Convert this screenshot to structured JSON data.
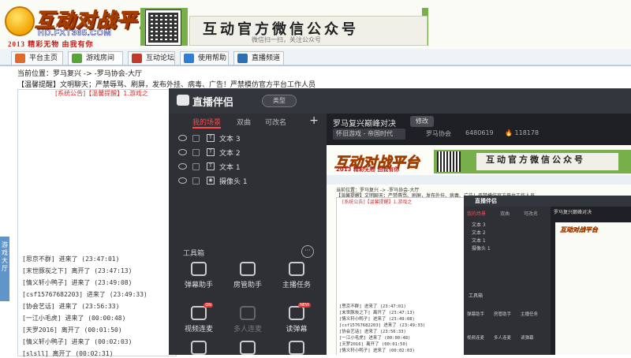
{
  "banner": {
    "logo_title": "互动对战平台",
    "logo_url": "HD.FXT365.COM",
    "logo_slogan": "2013 精彩无物 由我有你",
    "wechat_title": "互动官方微信公众号",
    "wechat_sub": "微信扫一扫，关注公众号"
  },
  "nav": {
    "tabs": [
      {
        "label": "平台主页",
        "icon": "home-icon",
        "color": "#e06a2b"
      },
      {
        "label": "游戏房间",
        "icon": "game-room-icon",
        "color": "#5aa33a"
      },
      {
        "label": "互动论坛",
        "icon": "forum-icon",
        "color": "#c0392b"
      },
      {
        "label": "使用帮助",
        "icon": "help-icon",
        "color": "#2d7fd1"
      },
      {
        "label": "直播频道",
        "icon": "live-icon",
        "color": "#2d6fb3"
      }
    ]
  },
  "location": "当前位置：罗马复兴 -> -罗马协会-大厅",
  "notice": "【温馨提醒】文明聊天；严禁辱骂、刷屏，发布外挂、病毒、广告！严禁模仿官方平台工作人员",
  "chat": {
    "header": "[系统公告]【温馨提醒】1.游戏之",
    "side_tab": "游戏大厅",
    "lines": [
      "[思京不群] 进来了 (23:47:01)",
      "[末世豚炭之下] 离开了 (23:47:13)",
      "[情义轩小鸭子] 进来了 (23:49:08)",
      "[csf15767682203] 进来了 (23:49:33)",
      "[协会艺话] 进来了 (23:56:33)",
      "[一江小毛虎] 进来了 (00:00:48)",
      "[天罗2016] 离开了 (00:01:50)",
      "[情义轩小鸭子] 进来了 (00:02:03)",
      "[slsll] 离开了 (00:02:31)"
    ]
  },
  "obs": {
    "app_name": "直播伴侣",
    "mode": "类型",
    "scene_tabs": [
      "我的场景",
      "双曲",
      "可改名"
    ],
    "sources": [
      {
        "type": "T",
        "name": "文本 3"
      },
      {
        "type": "T",
        "name": "文本 2"
      },
      {
        "type": "T",
        "name": "文本 1"
      },
      {
        "type": "◉",
        "name": "摄像头 1"
      }
    ],
    "tools_label": "工具箱",
    "tools": [
      {
        "label": "弹幕助手",
        "icon": "danmaku-helper-icon",
        "badge": ""
      },
      {
        "label": "房管助手",
        "icon": "room-admin-icon",
        "badge": ""
      },
      {
        "label": "主播任务",
        "icon": "streamer-task-icon",
        "badge": ""
      },
      {
        "label": "视频连麦",
        "icon": "video-link-icon",
        "badge": "ON"
      },
      {
        "label": "多人连麦",
        "icon": "multi-link-icon",
        "badge": ""
      },
      {
        "label": "读弹幕",
        "icon": "read-danmaku-icon",
        "badge": "NEW"
      }
    ]
  },
  "preview": {
    "title": "罗马复兴巅峰对决",
    "edit": "修改",
    "game": "怀旧游戏 - 帝国时代",
    "owner": "罗马协会",
    "room_id": "6480619",
    "heat": "118178"
  }
}
